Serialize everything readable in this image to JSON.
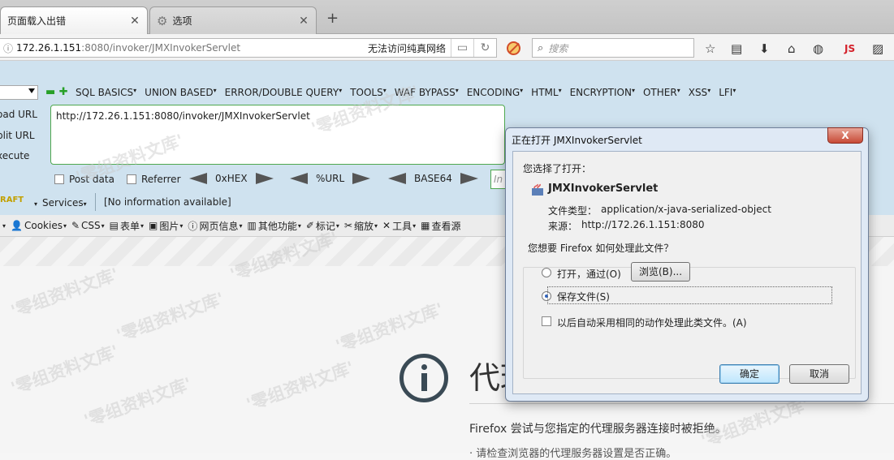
{
  "tabs": [
    {
      "title": "页面载入出错",
      "active": true
    },
    {
      "title": "选项",
      "active": false
    }
  ],
  "nav": {
    "url_host": "172.26.1.151",
    "url_rest": ":8080/invoker/JMXInvokerServlet",
    "network_status": "无法访问纯真网络",
    "search_placeholder": "搜索",
    "js_label": "JS"
  },
  "hackbar": {
    "menus": [
      "SQL BASICS",
      "UNION BASED",
      "ERROR/DOUBLE QUERY",
      "TOOLS",
      "WAF BYPASS",
      "ENCODING",
      "HTML",
      "ENCRYPTION",
      "OTHER",
      "XSS",
      "LFI"
    ],
    "side": [
      "oad URL",
      "plit URL",
      "xecute"
    ],
    "url_value": "http://172.26.1.151:8080/invoker/JMXInvokerServlet",
    "post_data": "Post data",
    "referrer": "Referrer",
    "hex": "0xHEX",
    "urlenc": "%URL",
    "base64": "BASE64",
    "input_placeholder": "In",
    "raft": "RAFT",
    "services": "Services",
    "noinfo": "[No information available]"
  },
  "devbar": [
    {
      "icon": "",
      "label": ""
    },
    {
      "icon": "👤",
      "label": "Cookies"
    },
    {
      "icon": "✎",
      "label": "CSS"
    },
    {
      "icon": "▤",
      "label": "表单"
    },
    {
      "icon": "▣",
      "label": "图片"
    },
    {
      "icon": "ⓘ",
      "label": "网页信息"
    },
    {
      "icon": "▥",
      "label": "其他功能"
    },
    {
      "icon": "✐",
      "label": "标记"
    },
    {
      "icon": "✂",
      "label": "缩放"
    },
    {
      "icon": "✕",
      "label": "工具"
    },
    {
      "icon": "▦",
      "label": "查看源"
    }
  ],
  "page": {
    "title": "代理",
    "description": "Firefox 尝试与您指定的代理服务器连接时被拒绝。",
    "hint": "· 请检查浏览器的代理服务器设置是否正确。",
    "watermark": "'零组资料文库'"
  },
  "dialog": {
    "title": "正在打开 JMXInvokerServlet",
    "close": "X",
    "chosen_label": "您选择了打开：",
    "filename": "JMXInvokerServlet",
    "type_label": "文件类型：",
    "type_value": "application/x-java-serialized-object",
    "source_label": "来源：",
    "source_value": "http://172.26.1.151:8080",
    "question": "您想要 Firefox 如何处理此文件？",
    "open_with": "打开，通过(O)",
    "browse": "浏览(B)...",
    "save_file": "保存文件(S)",
    "auto_action": "以后自动采用相同的动作处理此类文件。(A)",
    "ok": "确定",
    "cancel": "取消"
  }
}
